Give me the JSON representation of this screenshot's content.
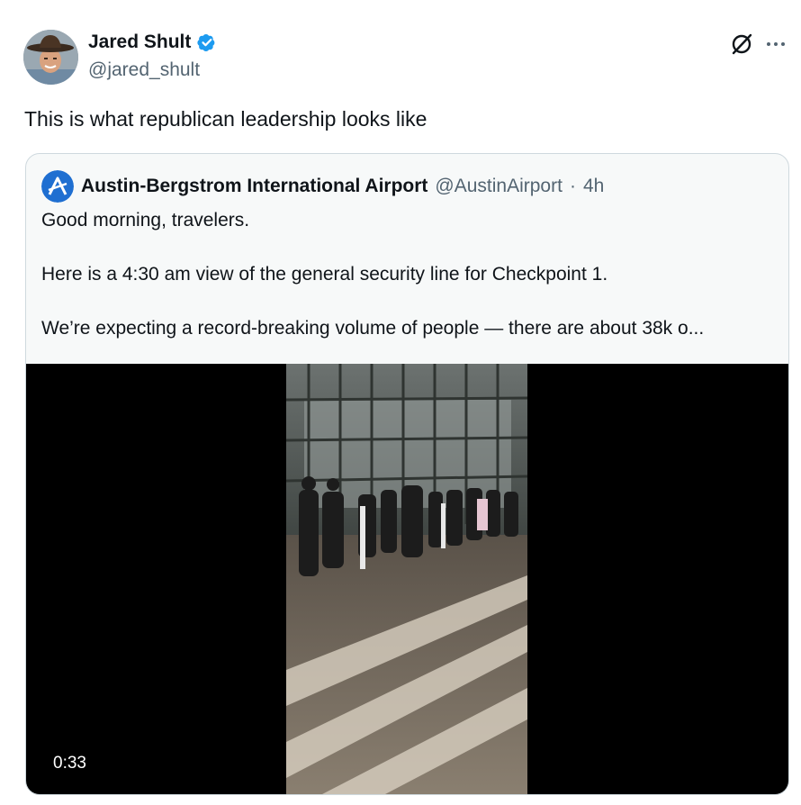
{
  "author": {
    "name": "Jared Shult",
    "handle": "@jared_shult"
  },
  "header_icons": [
    "grok-icon",
    "more-icon"
  ],
  "tweet": {
    "text": "This is what republican leadership looks like"
  },
  "quote": {
    "author_name": "Austin-Bergstrom International Airport",
    "author_handle": "@AustinAirport",
    "separator": "·",
    "time": "4h",
    "lines": [
      "Good morning, travelers.",
      "Here is a 4:30 am view of the general security line for Checkpoint 1.",
      "We’re expecting a record-breaking volume of people — there are about 38k o..."
    ],
    "video": {
      "duration": "0:33"
    }
  },
  "colors": {
    "verified": "#1d9bf0",
    "text_primary": "#0f1419",
    "text_secondary": "#536471",
    "card_border": "#cfd9de",
    "card_background": "#f7f9f9"
  }
}
